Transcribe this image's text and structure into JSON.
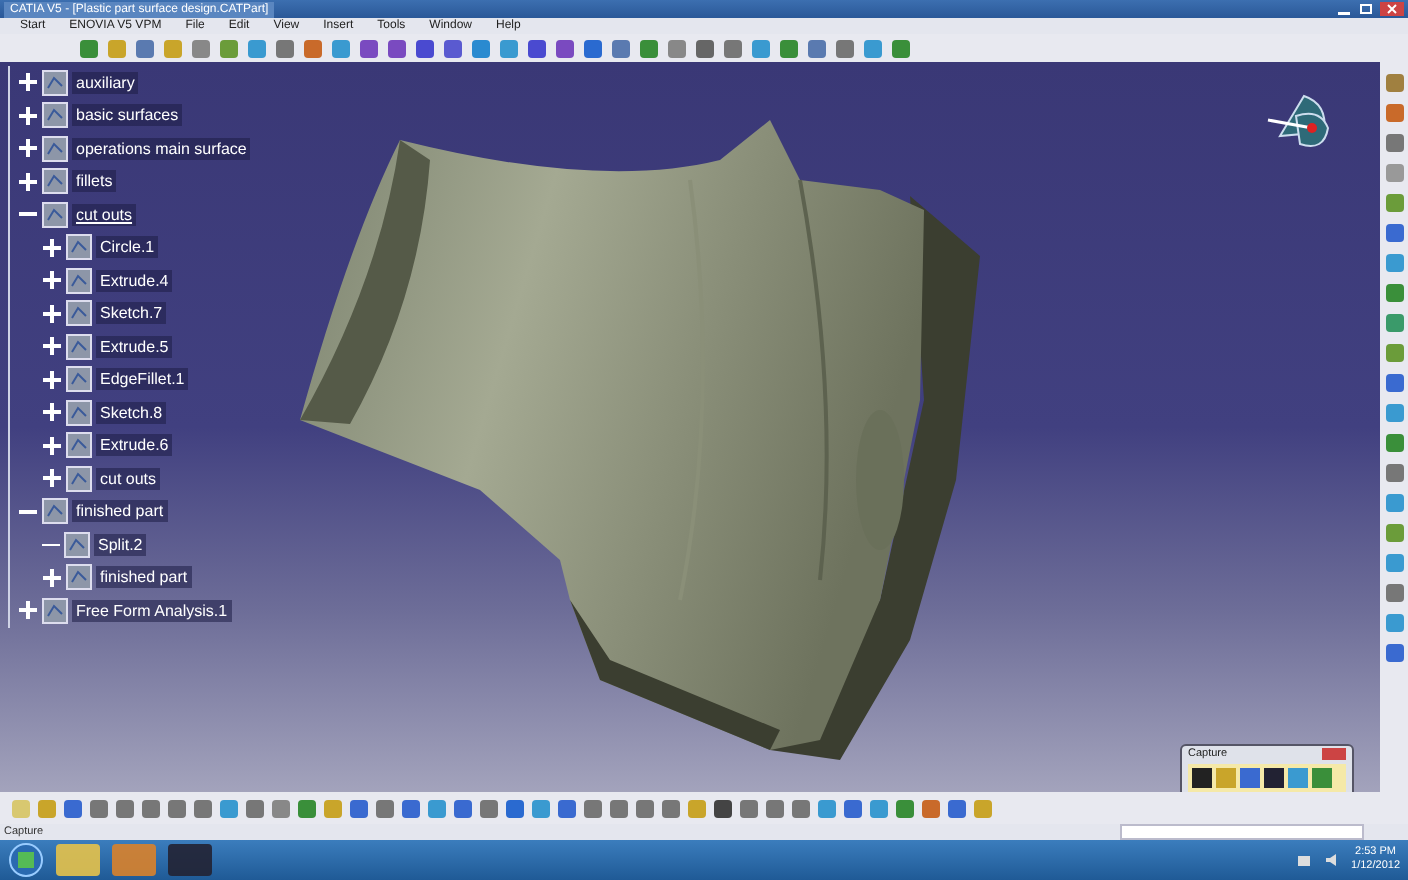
{
  "window": {
    "title": "CATIA V5 - [Plastic part surface design.CATPart]"
  },
  "menu": [
    "Start",
    "ENOVIA V5 VPM",
    "File",
    "Edit",
    "View",
    "Insert",
    "Tools",
    "Window",
    "Help"
  ],
  "tree": [
    {
      "label": "auxiliary",
      "kind": "node",
      "expanded": false,
      "underlined": false
    },
    {
      "label": "basic surfaces",
      "kind": "node",
      "expanded": false,
      "underlined": false
    },
    {
      "label": "operations main surface",
      "kind": "node",
      "expanded": false,
      "underlined": false
    },
    {
      "label": "fillets",
      "kind": "node",
      "expanded": false,
      "underlined": false
    },
    {
      "label": "cut outs",
      "kind": "node",
      "expanded": true,
      "underlined": true,
      "children": [
        {
          "label": "Circle.1",
          "kind": "node",
          "expanded": false,
          "underlined": false
        },
        {
          "label": "Extrude.4",
          "kind": "node",
          "expanded": false,
          "underlined": false
        },
        {
          "label": "Sketch.7",
          "kind": "node",
          "expanded": false,
          "underlined": false
        },
        {
          "label": "Extrude.5",
          "kind": "node",
          "expanded": false,
          "underlined": false
        },
        {
          "label": "EdgeFillet.1",
          "kind": "node",
          "expanded": false,
          "underlined": false
        },
        {
          "label": "Sketch.8",
          "kind": "node",
          "expanded": false,
          "underlined": false
        },
        {
          "label": "Extrude.6",
          "kind": "node",
          "expanded": false,
          "underlined": false
        },
        {
          "label": "cut outs",
          "kind": "node",
          "expanded": false,
          "underlined": false
        }
      ]
    },
    {
      "label": "finished part",
      "kind": "node",
      "expanded": true,
      "underlined": false,
      "children": [
        {
          "label": "Split.2",
          "kind": "leaf",
          "underlined": false
        },
        {
          "label": "finished part",
          "kind": "node",
          "expanded": false,
          "underlined": false
        }
      ]
    },
    {
      "label": "Free Form Analysis.1",
      "kind": "node",
      "expanded": false,
      "underlined": false
    }
  ],
  "capture_window": {
    "title": "Capture"
  },
  "status_bar": {
    "text": "Capture"
  },
  "taskbar": {
    "time": "2:53 PM",
    "date": "1/12/2012"
  }
}
